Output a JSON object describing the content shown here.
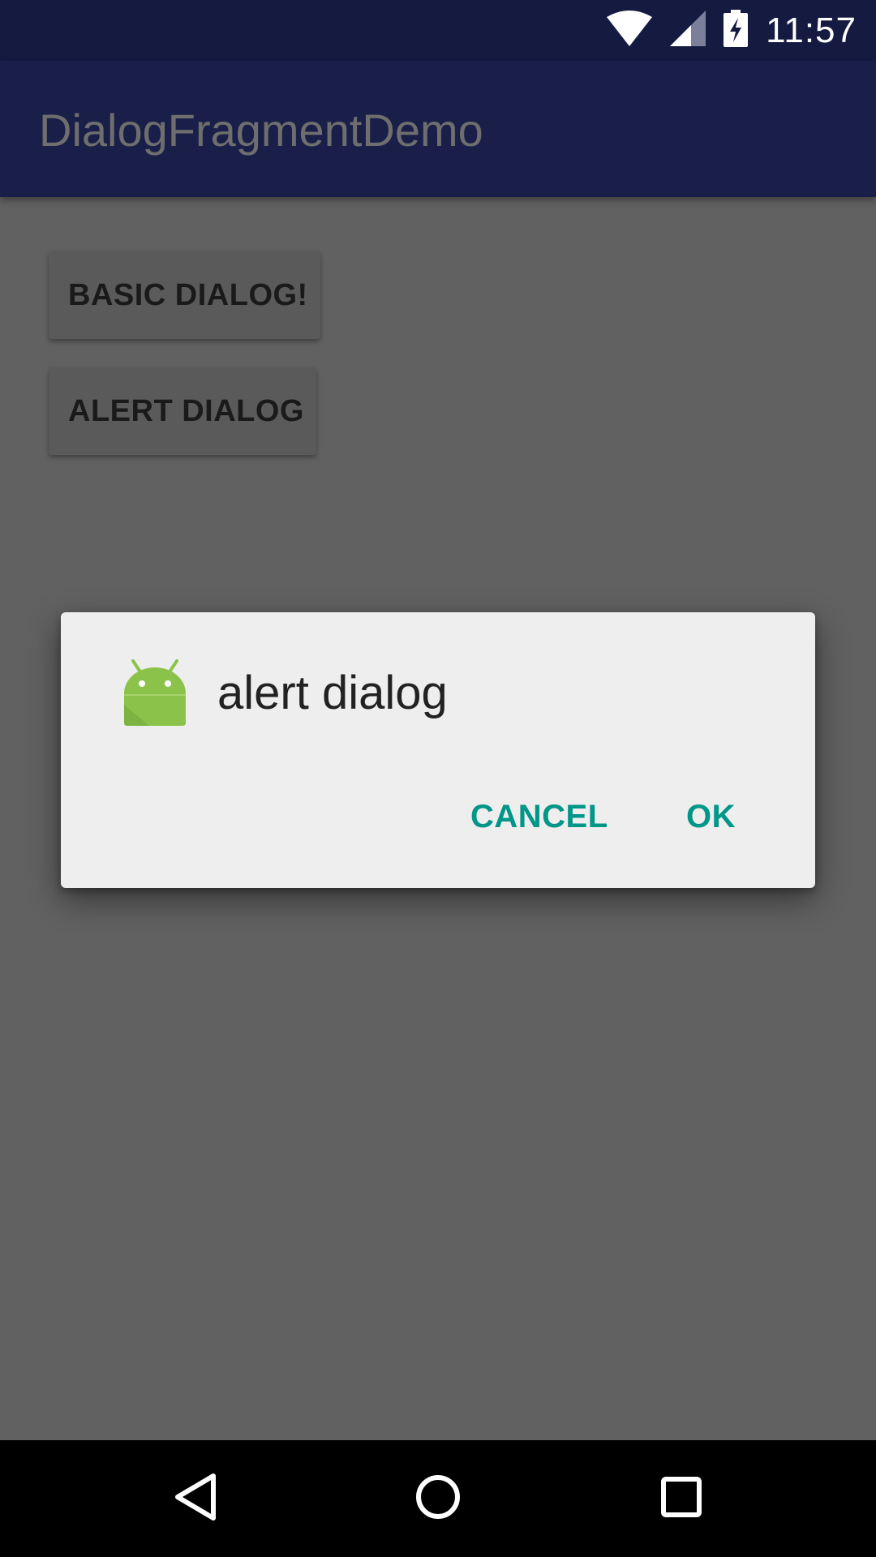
{
  "status_bar": {
    "time": "11:57",
    "icons": [
      "wifi-icon",
      "signal-icon",
      "battery-charging-icon"
    ]
  },
  "app_bar": {
    "title": "DialogFragmentDemo"
  },
  "main": {
    "buttons": [
      {
        "label": "BASIC DIALOG!"
      },
      {
        "label": "ALERT DIALOG"
      }
    ]
  },
  "dialog": {
    "icon": "android-icon",
    "title": "alert dialog",
    "cancel_label": "CANCEL",
    "ok_label": "OK",
    "accent_color": "#009688"
  },
  "nav_bar": {
    "icons": [
      "back-icon",
      "home-icon",
      "recents-icon"
    ]
  },
  "colors": {
    "status_bar": "#151a41",
    "app_bar": "#1a1f49",
    "scrim_background": "#616161",
    "dialog_background": "#eeeeee"
  }
}
